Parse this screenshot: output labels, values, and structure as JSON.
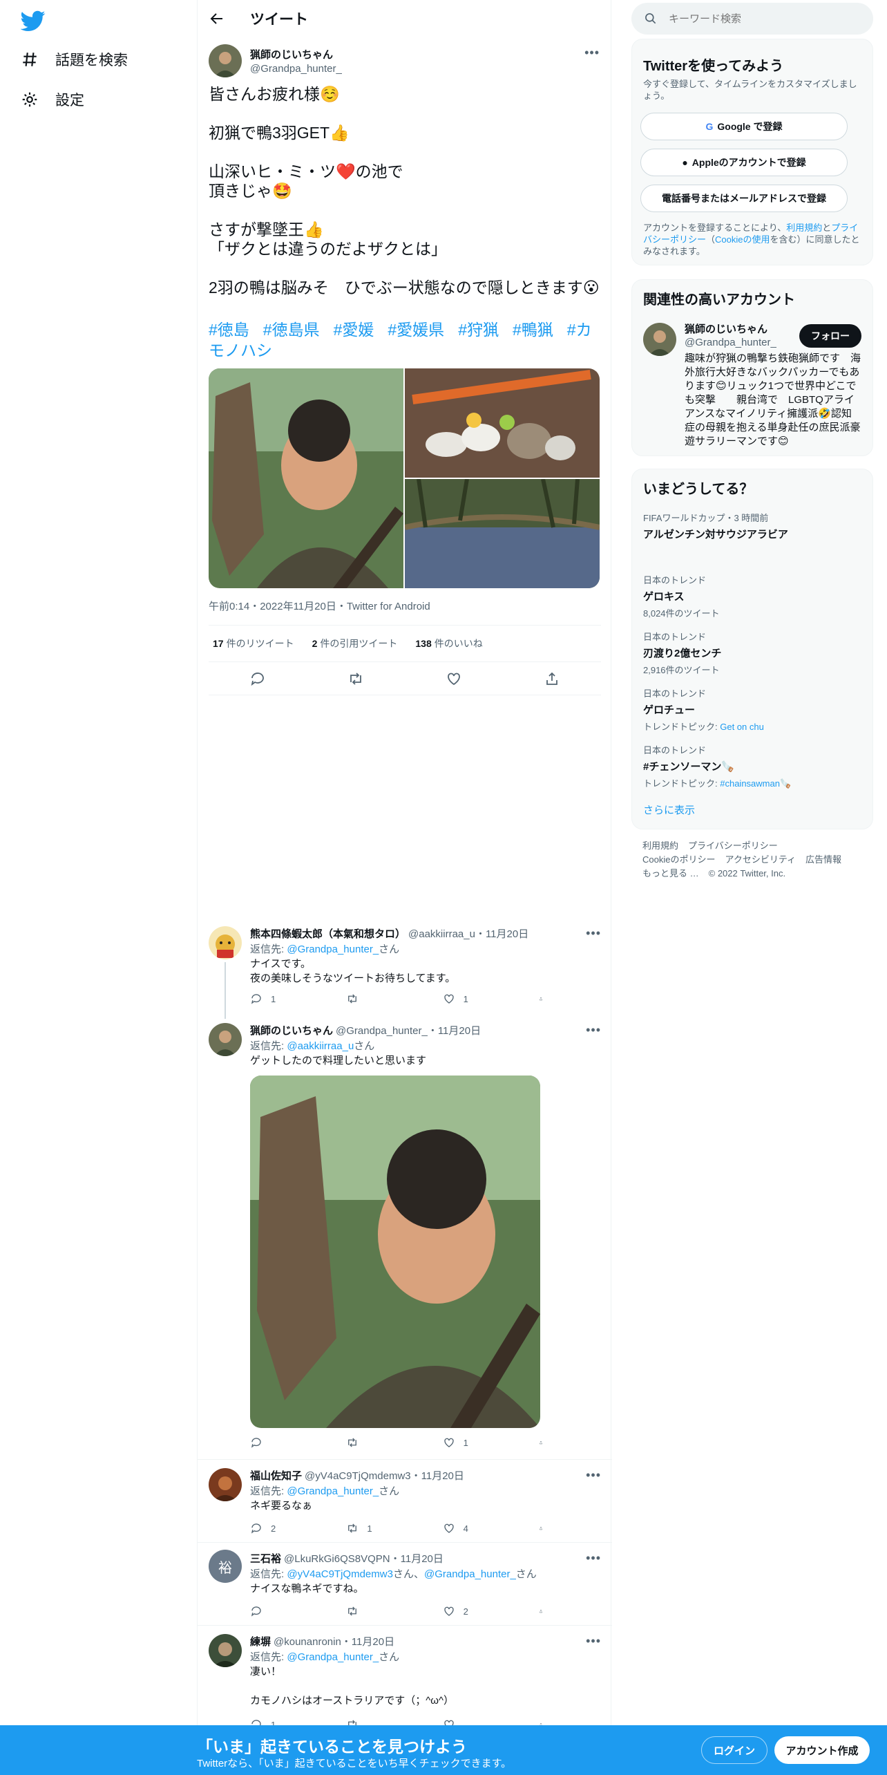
{
  "nav": {
    "items": [
      {
        "label": "話題を検索",
        "icon": "hashtag-icon"
      },
      {
        "label": "設定",
        "icon": "gear-icon"
      }
    ]
  },
  "header": {
    "title": "ツイート"
  },
  "tweet": {
    "author_name": "猟師のじいちゃん",
    "author_handle": "@Grandpa_hunter_",
    "body": [
      "皆さんお疲れ様☺️",
      "初猟で鴨3羽GET👍",
      "山深いヒ・ミ・ツ❤️の池で\n頂きじゃ🤩",
      "さすが撃墜王👍\n「ザクとは違うのだよザクとは」",
      "2羽の鴨は脳みそ　ひでぶー状態なので隠しときます😮"
    ],
    "hashtags": [
      "#徳島",
      "#徳島県",
      "#愛媛",
      "#愛媛県",
      "#狩猟",
      "#鴨猟",
      "#カモノハシ"
    ],
    "meta": "午前0:14・2022年11月20日・Twitter for Android",
    "retweets": "17",
    "retweets_label": "件のリツイート",
    "quotes": "2",
    "quotes_label": "件の引用ツイート",
    "likes": "138",
    "likes_label": "件のいいね"
  },
  "replies": [
    {
      "name": "熊本四條蝦太郎（本氣和想タロ）",
      "handle": "@aakkiirraa_u・11月20日",
      "reply_prefix": "返信先: ",
      "reply_to": "@Grandpa_hunter_",
      "reply_suffix": "さん",
      "text": "ナイスです。\n夜の美味しそうなツイートお待ちしてます。",
      "replies": "1",
      "retweets": "",
      "likes": "1"
    },
    {
      "name": "猟師のじいちゃん",
      "handle": "@Grandpa_hunter_・11月20日",
      "reply_prefix": "返信先: ",
      "reply_to": "@aakkiirraa_u",
      "reply_suffix": "さん",
      "text": "ゲットしたので料理したいと思います",
      "replies": "",
      "retweets": "",
      "likes": "1"
    },
    {
      "name": "福山佐知子",
      "handle": "@yV4aC9TjQmdemw3・11月20日",
      "reply_prefix": "返信先: ",
      "reply_to": "@Grandpa_hunter_",
      "reply_suffix": "さん",
      "text": "ネギ要るなぁ",
      "replies": "2",
      "retweets": "1",
      "likes": "4"
    },
    {
      "name": "三石裕",
      "handle": "@LkuRkGi6QS8VQPN・11月20日",
      "avatar_letter": "裕",
      "reply_prefix": "返信先: ",
      "reply_to": "@yV4aC9TjQmdemw3",
      "reply_mid": "さん、",
      "reply_to2": "@Grandpa_hunter_",
      "reply_suffix": "さん",
      "text": "ナイスな鴨ネギですね。",
      "replies": "",
      "retweets": "",
      "likes": "2"
    },
    {
      "name": "練塀",
      "handle": "@kounanronin・11月20日",
      "reply_prefix": "返信先: ",
      "reply_to": "@Grandpa_hunter_",
      "reply_suffix": "さん",
      "text": "凄い！\n\nカモノハシはオーストラリアです（；^ω^）",
      "replies": "1",
      "retweets": "",
      "likes": ""
    }
  ],
  "right": {
    "search_placeholder": "キーワード検索",
    "signup": {
      "title": "Twitterを使ってみよう",
      "subtitle": "今すぐ登録して、タイムラインをカスタマイズしましょう。",
      "google": "Google で登録",
      "apple": "Appleのアカウントで登録",
      "phone": "電話番号またはメールアドレスで登録",
      "terms_1": "アカウントを登録することにより、",
      "terms_link1": "利用規約",
      "terms_2": "と",
      "terms_link2": "プライバシーポリシー",
      "terms_3": "（",
      "terms_link3": "Cookieの使用",
      "terms_4": "を含む）に同意したとみなされます。"
    },
    "related": {
      "title": "関連性の高いアカウント",
      "name": "猟師のじいちゃん",
      "handle": "@Grandpa_hunter_",
      "follow": "フォロー",
      "bio": "趣味が狩猟の鴨撃ち鉄砲猟師です　海外旅行大好きなバックパッカーでもあります😊リュック1つで世界中どこでも突撃　　親台湾で　LGBTQアライアンスなマイノリティ擁護派🤣認知症の母親を抱える単身赴任の庶民派豪遊サラリーマンです😊"
    },
    "trends": {
      "title": "いまどうしてる？",
      "items": [
        {
          "context": "FIFAワールドカップ・3 時間前",
          "title": "アルゼンチン対サウジアラビア",
          "sub": "",
          "sub_link": ""
        },
        {
          "context": "日本のトレンド",
          "title": "ゲロキス",
          "sub": "8,024件のツイート",
          "sub_link": ""
        },
        {
          "context": "日本のトレンド",
          "title": "刃渡り2億センチ",
          "sub": "2,916件のツイート",
          "sub_link": ""
        },
        {
          "context": "日本のトレンド",
          "title": "ゲロチュー",
          "sub": "トレンドトピック: ",
          "sub_link": "Get on chu"
        },
        {
          "context": "日本のトレンド",
          "title": "#チェンソーマン🪚",
          "sub": "トレンドトピック: ",
          "sub_link": "#chainsawman🪚"
        }
      ],
      "more": "さらに表示"
    },
    "footer": {
      "links": [
        "利用規約",
        "プライバシーポリシー",
        "Cookieのポリシー",
        "アクセシビリティ",
        "広告情報",
        "もっと見る …",
        "© 2022 Twitter, Inc."
      ]
    }
  },
  "banner": {
    "title": "「いま」起きていることを見つけよう",
    "subtitle": "Twitterなら、「いま」起きていることをいち早くチェックできます。",
    "login": "ログイン",
    "signup": "アカウント作成"
  },
  "colors": {
    "accent": "#1d9bf0",
    "text": "#0f1419",
    "muted": "#536471"
  }
}
